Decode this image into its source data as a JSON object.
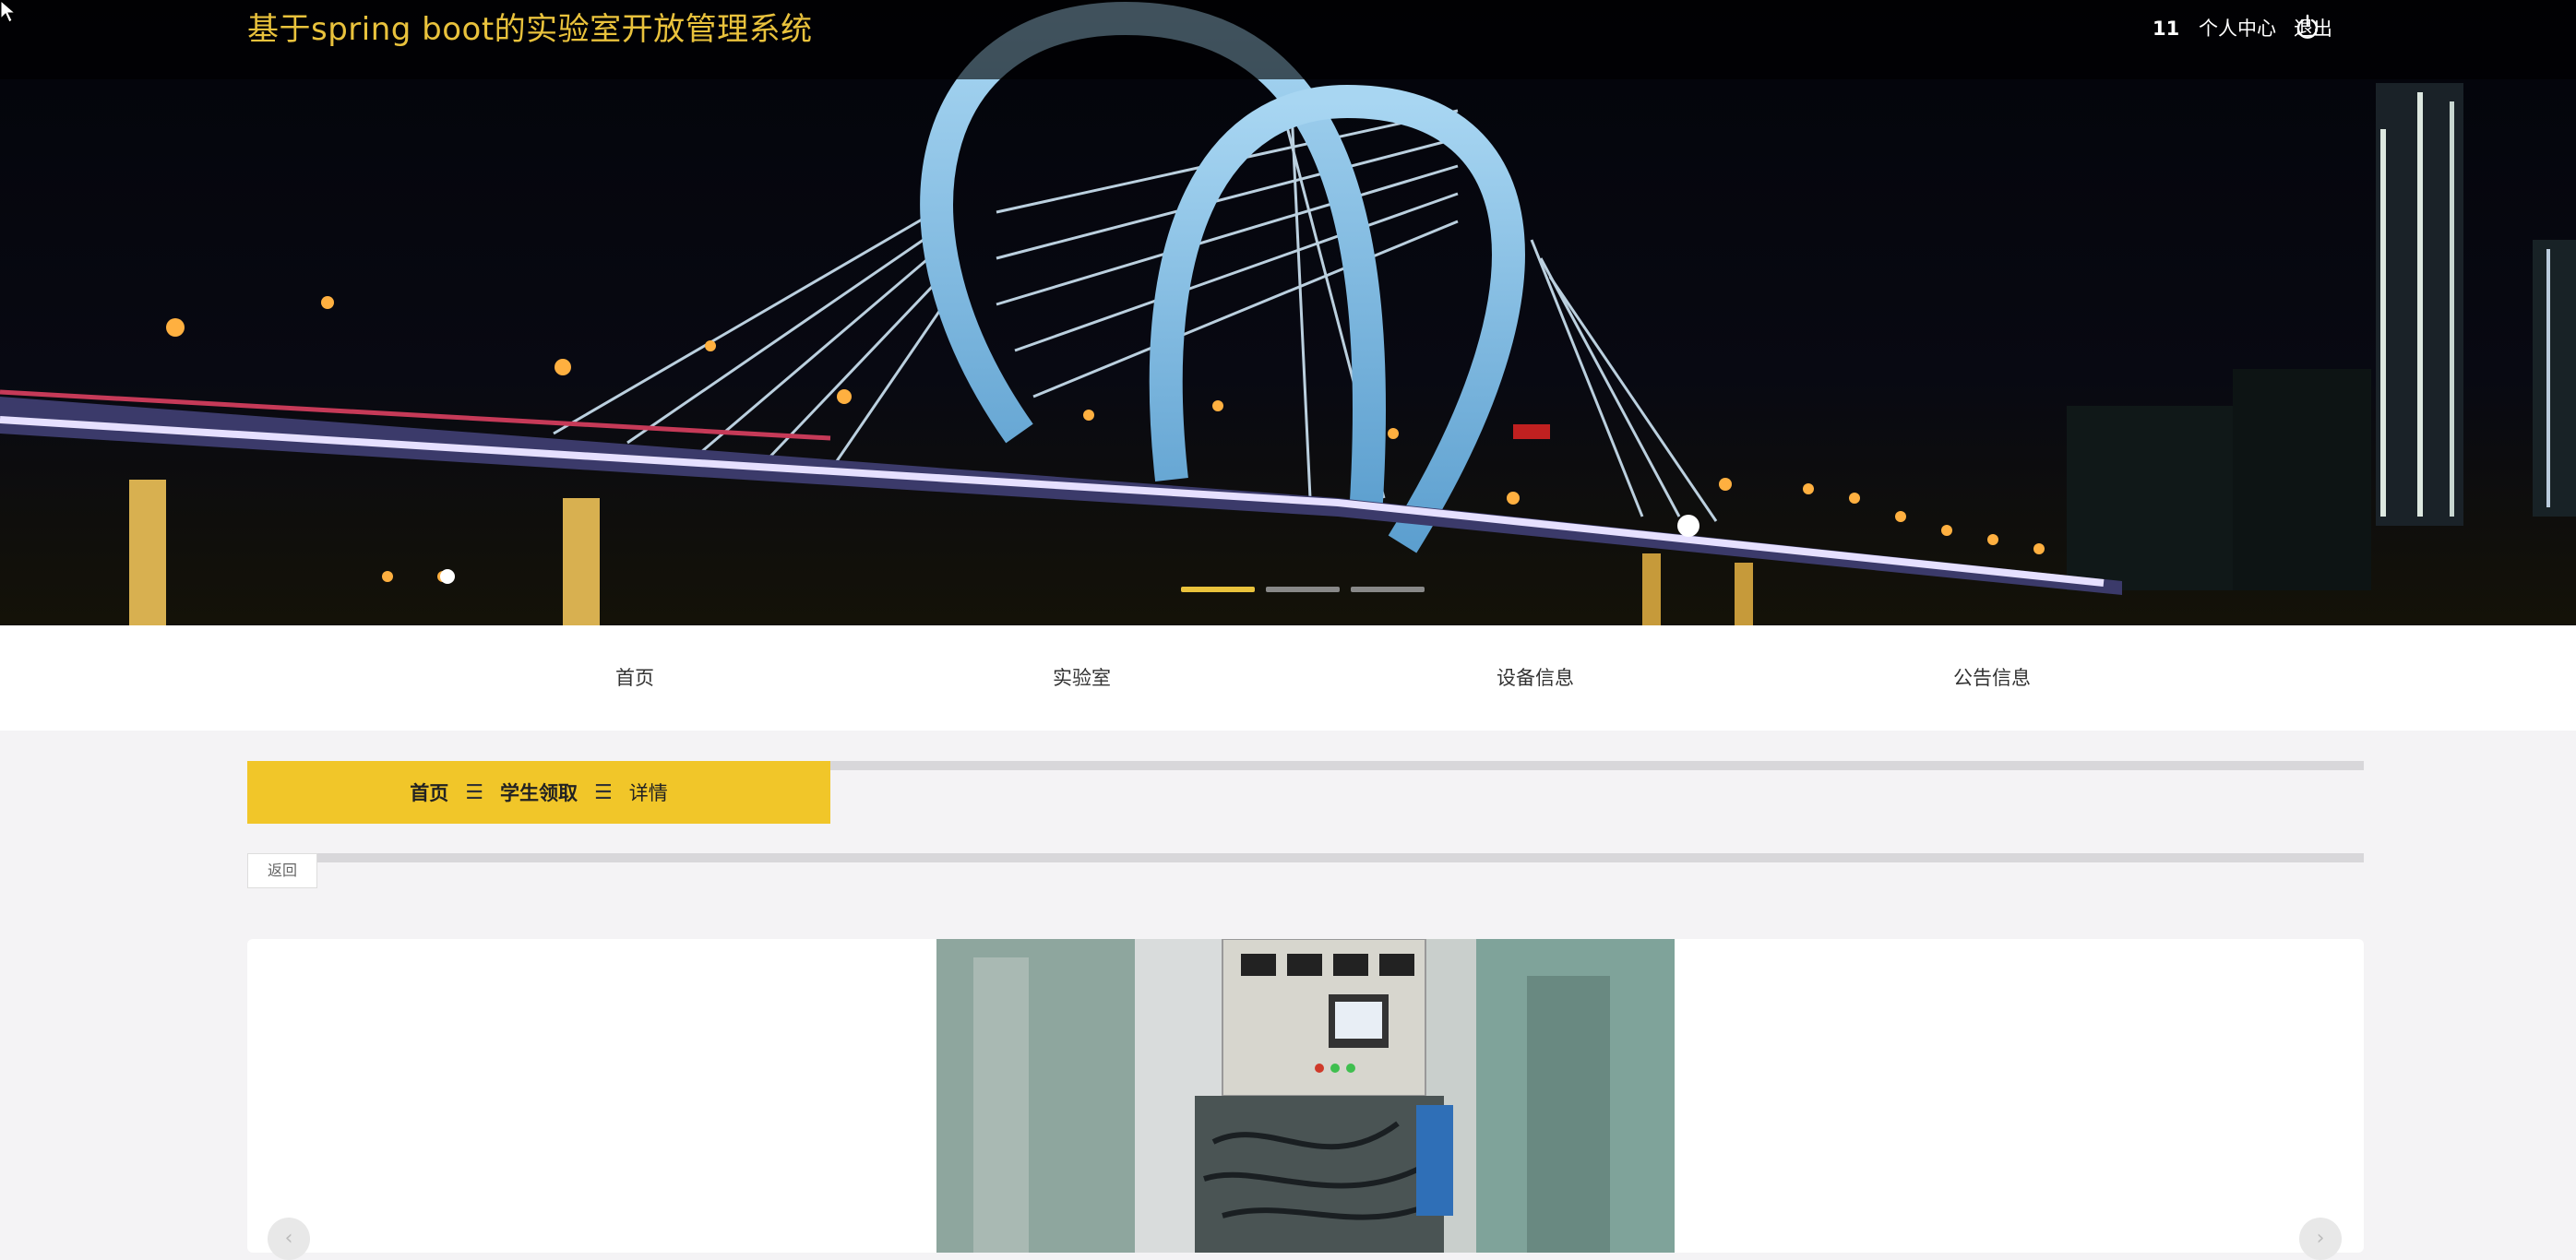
{
  "header": {
    "title": "基于spring boot的实验室开放管理系统",
    "user_id": "11",
    "personal_center": "个人中心",
    "logout": "退出"
  },
  "carousel": {
    "active_index": 0,
    "count": 3
  },
  "nav": {
    "items": [
      {
        "label": "首页"
      },
      {
        "label": "实验室"
      },
      {
        "label": "设备信息"
      },
      {
        "label": "公告信息"
      }
    ]
  },
  "breadcrumb": {
    "home": "首页",
    "section": "学生领取",
    "current": "详情",
    "separator": "☰"
  },
  "actions": {
    "back": "返回"
  },
  "colors": {
    "accent": "#f1c629",
    "title": "#e9c23c"
  },
  "icons": {
    "logout": "power-icon",
    "prev": "chevron-left-icon",
    "next": "chevron-right-icon"
  }
}
